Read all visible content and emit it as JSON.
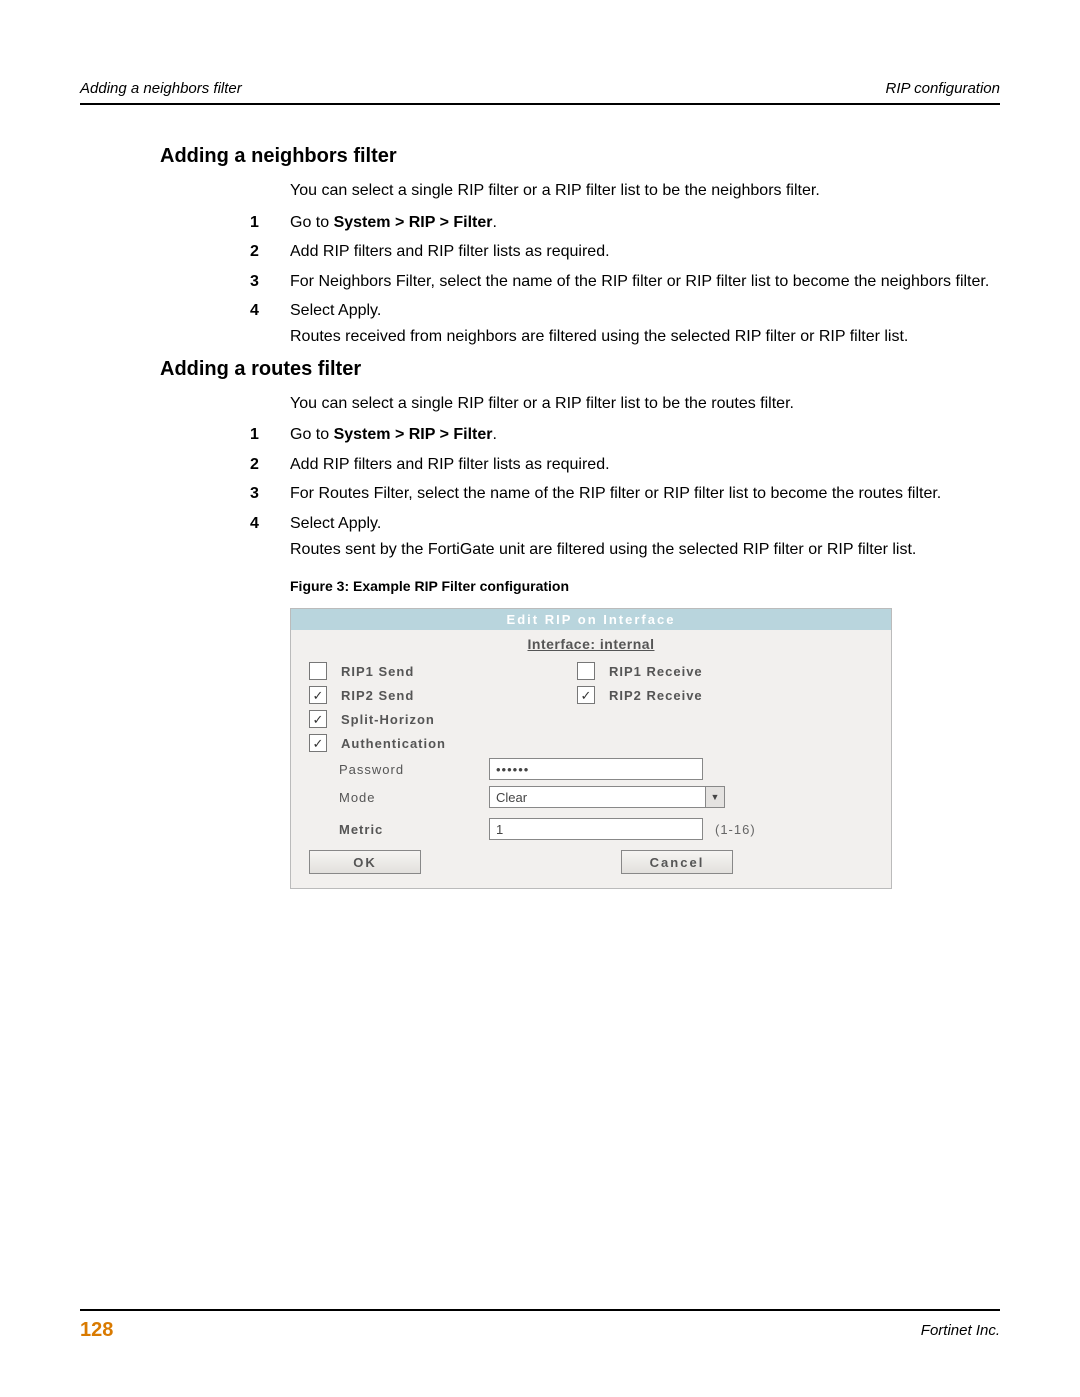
{
  "header": {
    "left": "Adding a neighbors filter",
    "right": "RIP configuration"
  },
  "section1": {
    "title": "Adding a neighbors filter",
    "intro": "You can select a single RIP filter or a RIP filter list to be the neighbors filter.",
    "steps": {
      "s1_pre": "Go to ",
      "s1_bold": "System > RIP > Filter",
      "s1_post": ".",
      "s2": "Add RIP filters and RIP filter lists as required.",
      "s3": "For Neighbors Filter, select the name of the RIP filter or RIP filter list to become the neighbors filter.",
      "s4a": "Select Apply.",
      "s4b": "Routes received from neighbors are filtered using the selected RIP filter or RIP filter list."
    }
  },
  "section2": {
    "title": "Adding a routes filter",
    "intro": "You can select a single RIP filter or a RIP filter list to be the routes filter.",
    "steps": {
      "s1_pre": "Go to ",
      "s1_bold": "System > RIP > Filter",
      "s1_post": ".",
      "s2": "Add RIP filters and RIP filter lists as required.",
      "s3": "For Routes Filter, select the name of the RIP filter or RIP filter list to become the routes filter.",
      "s4a": "Select Apply.",
      "s4b": "Routes sent by the FortiGate unit are filtered using the selected RIP filter or RIP filter list."
    }
  },
  "figure": {
    "caption": "Figure 3:  Example RIP Filter configuration",
    "panel": {
      "title": "Edit RIP on Interface",
      "subtitle": "Interface: internal",
      "rip1send": "RIP1 Send",
      "rip1recv": "RIP1 Receive",
      "rip2send": "RIP2 Send",
      "rip2recv": "RIP2 Receive",
      "split": "Split-Horizon",
      "auth": "Authentication",
      "password_label": "Password",
      "password_value": "••••••",
      "mode_label": "Mode",
      "mode_value": "Clear",
      "metric_label": "Metric",
      "metric_value": "1",
      "metric_hint": "(1-16)",
      "ok": "OK",
      "cancel": "Cancel",
      "checks": {
        "rip1send": "",
        "rip1recv": "",
        "rip2send": "✓",
        "rip2recv": "✓",
        "split": "✓",
        "auth": "✓"
      }
    }
  },
  "footer": {
    "page": "128",
    "company": "Fortinet Inc."
  }
}
